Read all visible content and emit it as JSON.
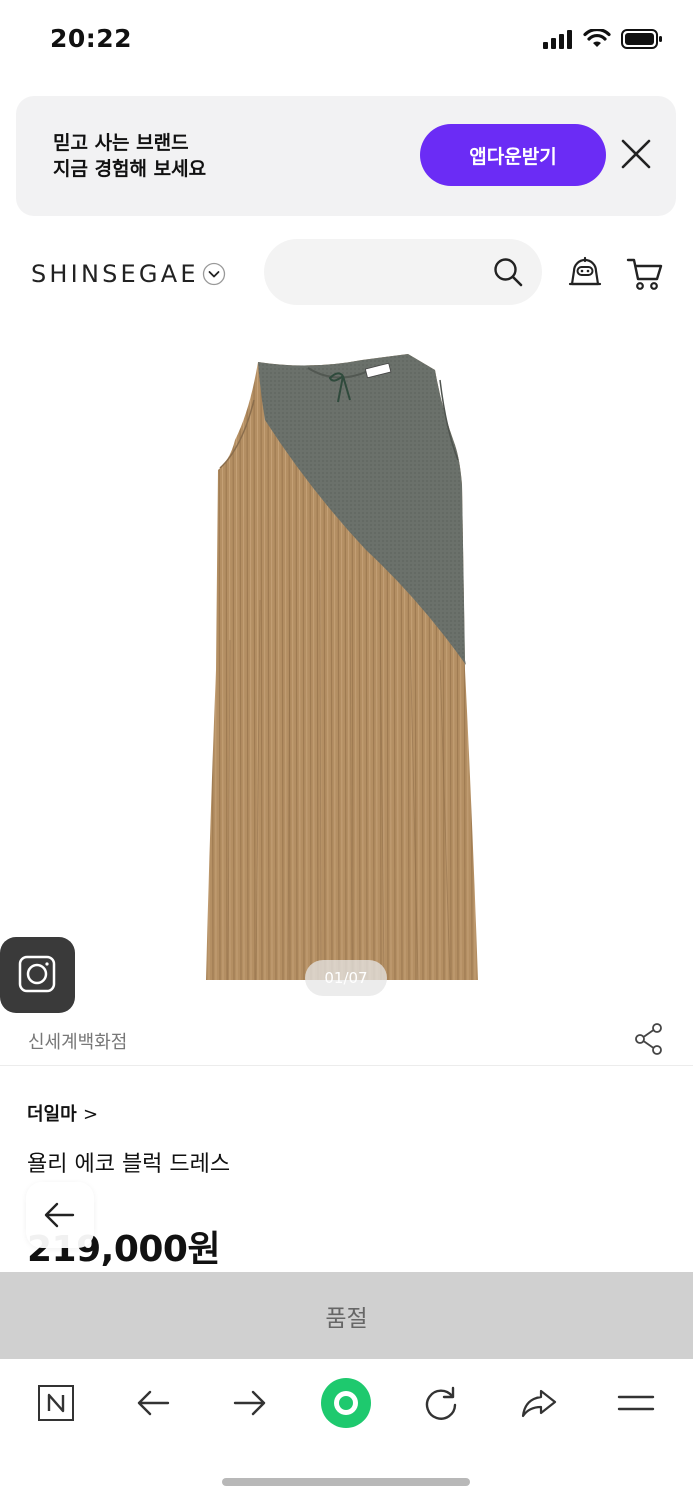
{
  "status_bar": {
    "time": "20:22"
  },
  "app_banner": {
    "line1": "믿고 사는 브랜드",
    "line2": "지금 경험해 보세요",
    "button_label": "앱다운받기",
    "accent_color": "#6b2cf5"
  },
  "header": {
    "logo": "SHINSEGAE",
    "search": {
      "placeholder": ""
    }
  },
  "product": {
    "image_counter": "01/07",
    "store": "신세계백화점",
    "brand": "더일마",
    "name": "욜리 에코 블럭 드레스",
    "price": "219,000원",
    "soldout_label": "품절"
  },
  "icons": {
    "status": [
      "signal-icon",
      "wifi-icon",
      "battery-icon"
    ],
    "header": [
      "chevron-down-icon",
      "search-icon",
      "chatbot-icon",
      "cart-icon"
    ],
    "toolbar": [
      "naver-n-icon",
      "back-arrow-icon",
      "forward-arrow-icon",
      "green-dot-icon",
      "reload-icon",
      "share-arrow-icon",
      "menu-icon"
    ]
  }
}
